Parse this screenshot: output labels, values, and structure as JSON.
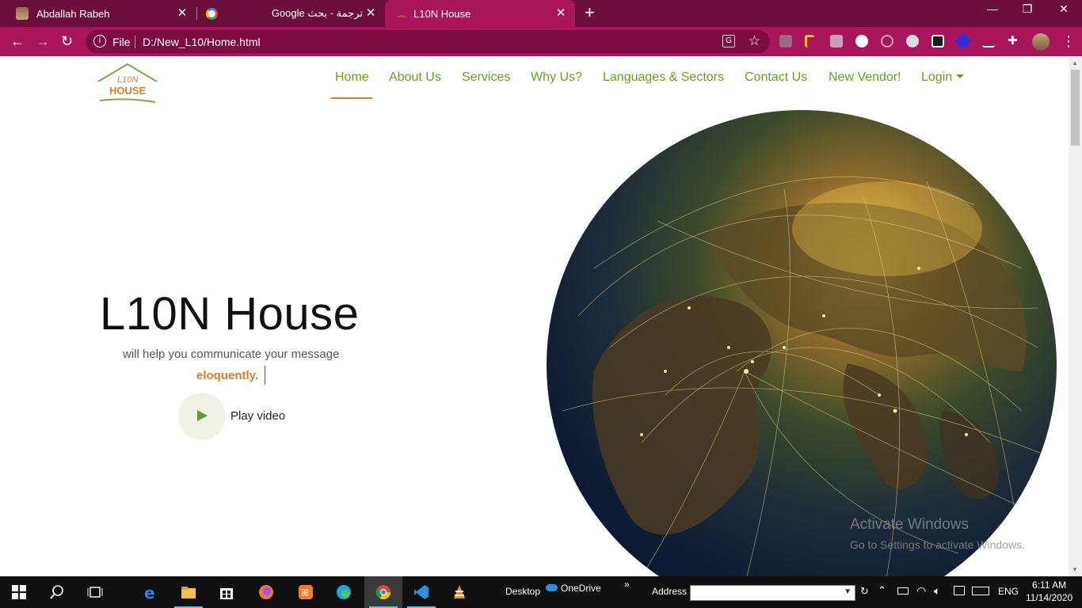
{
  "browser": {
    "tabs": [
      {
        "title": "Abdallah Rabeh"
      },
      {
        "title": "Google ترجمة - بحث"
      },
      {
        "title": "L10N House"
      }
    ],
    "new_tab_symbol": "+",
    "window_controls": {
      "minimize": "—",
      "maximize": "❐",
      "close": "✕"
    },
    "omnibox": {
      "scheme": "File",
      "url": "D:/New_L10/Home.html"
    }
  },
  "site": {
    "logo_text": [
      "L10N",
      "HOUSE"
    ],
    "nav": [
      {
        "label": "Home",
        "active": true
      },
      {
        "label": "About Us"
      },
      {
        "label": "Services"
      },
      {
        "label": "Why Us?"
      },
      {
        "label": "Languages & Sectors"
      },
      {
        "label": "Contact Us"
      },
      {
        "label": "New Vendor!"
      },
      {
        "label": "Login"
      }
    ],
    "hero": {
      "title": "L10N House",
      "subtitle": "will help you communicate your message",
      "typed_word": "eloquently.",
      "play_label": "Play video"
    },
    "colors": {
      "brand_green": "#6a9e1f",
      "accent_orange": "#e07a2d",
      "chrome_purple": "#a8155b"
    }
  },
  "watermark": {
    "line1": "Activate Windows",
    "line2": "Go to Settings to activate Windows."
  },
  "taskbar": {
    "desktop_label": "Desktop",
    "onedrive_label": "OneDrive",
    "address_label": "Address",
    "overflow": "»",
    "language": "ENG",
    "time": "6:11 AM",
    "date": "11/14/2020"
  }
}
